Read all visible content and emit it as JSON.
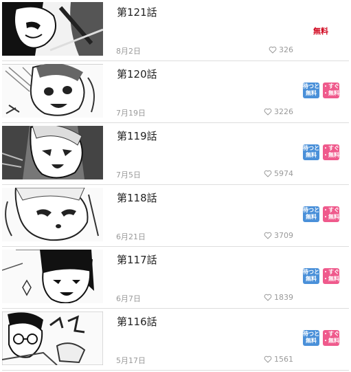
{
  "episodes": [
    {
      "title": "第121話",
      "date": "8月2日",
      "likes": "326",
      "free_label": "無料"
    },
    {
      "title": "第120話",
      "date": "7月19日",
      "likes": "3226",
      "badge_wait": [
        "待つと",
        "無料"
      ],
      "badge_now": [
        "・すぐ",
        "・無料"
      ]
    },
    {
      "title": "第119話",
      "date": "7月5日",
      "likes": "5974",
      "badge_wait": [
        "待つと",
        "無料"
      ],
      "badge_now": [
        "・すぐ",
        "・無料"
      ]
    },
    {
      "title": "第118話",
      "date": "6月21日",
      "likes": "3709",
      "badge_wait": [
        "待つと",
        "無料"
      ],
      "badge_now": [
        "・すぐ",
        "・無料"
      ]
    },
    {
      "title": "第117話",
      "date": "6月7日",
      "likes": "1839",
      "badge_wait": [
        "待つと",
        "無料"
      ],
      "badge_now": [
        "・すぐ",
        "・無料"
      ]
    },
    {
      "title": "第116話",
      "date": "5月17日",
      "likes": "1561",
      "badge_wait": [
        "待つと",
        "無料"
      ],
      "badge_now": [
        "・すぐ",
        "・無料"
      ]
    }
  ],
  "colors": {
    "free_text": "#d0021b",
    "badge_wait": "#4a90d9",
    "badge_now": "#ef5a8c",
    "muted_text": "#999999"
  },
  "icons": {
    "like": "heart-outline-icon"
  }
}
